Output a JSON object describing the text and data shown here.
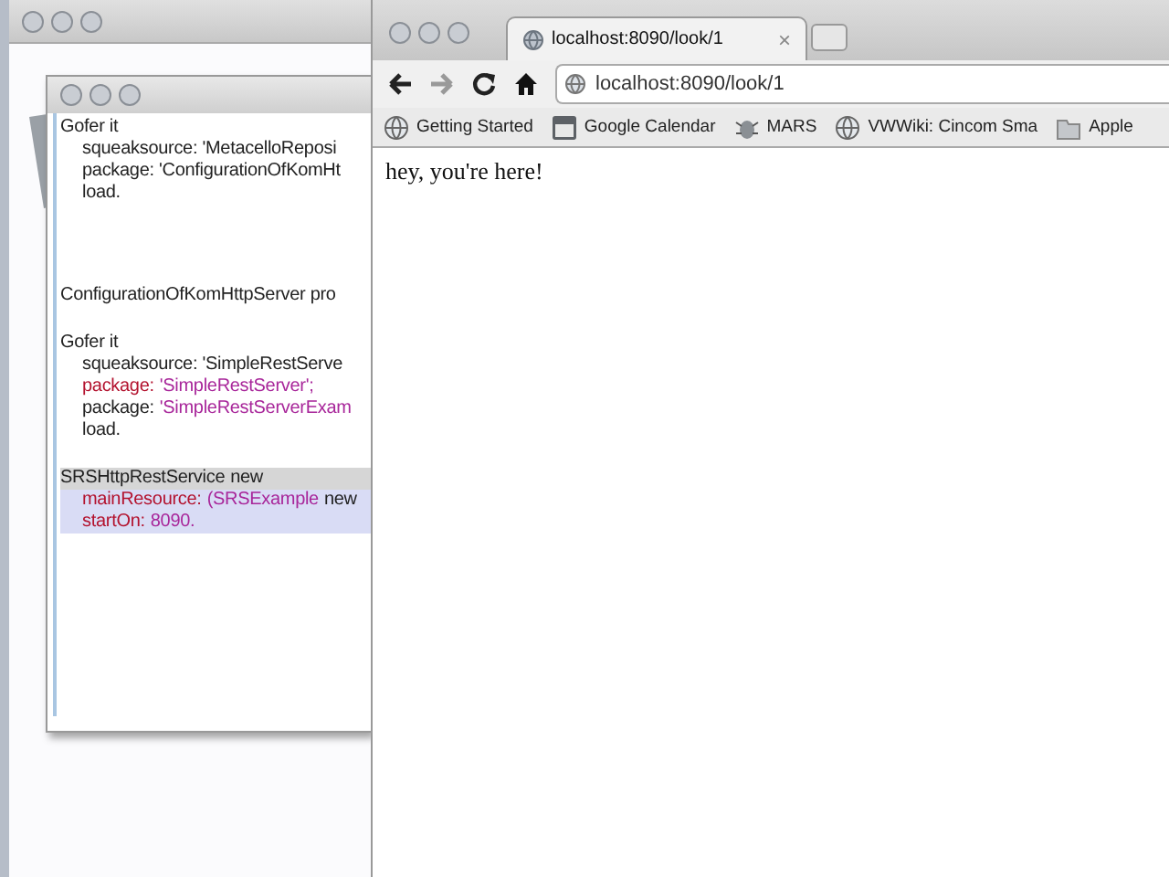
{
  "workspace": {
    "blocks": [
      {
        "lines": [
          {
            "segments": [
              {
                "text": "Gofer it",
                "kind": "plain"
              }
            ],
            "children": [
              {
                "segments": [
                  {
                    "text": "squeaksource: 'MetacelloReposi",
                    "kind": "plain"
                  }
                ]
              },
              {
                "segments": [
                  {
                    "text": "package: 'ConfigurationOfKomHt",
                    "kind": "plain"
                  }
                ]
              },
              {
                "segments": [
                  {
                    "text": "load.",
                    "kind": "plain"
                  }
                ]
              }
            ]
          }
        ]
      },
      {
        "lines": [
          {
            "segments": [
              {
                "text": "ConfigurationOfKomHttpServer pro",
                "kind": "plain"
              }
            ]
          }
        ]
      },
      {
        "lines": [
          {
            "segments": [
              {
                "text": "Gofer it",
                "kind": "plain"
              }
            ],
            "children": [
              {
                "segments": [
                  {
                    "text": "squeaksource: 'SimpleRestServe",
                    "kind": "plain"
                  }
                ]
              },
              {
                "segments": [
                  {
                    "text": "package:",
                    "kind": "keyword"
                  },
                  {
                    "text": "'SimpleRestServer';",
                    "kind": "string"
                  }
                ]
              },
              {
                "segments": [
                  {
                    "text": "package:",
                    "kind": "plain"
                  },
                  {
                    "text": "'SimpleRestServerExam",
                    "kind": "string"
                  }
                ]
              },
              {
                "segments": [
                  {
                    "text": "load.",
                    "kind": "plain"
                  }
                ]
              }
            ]
          }
        ]
      },
      {
        "lines": [
          {
            "color": "#d6d6d6",
            "segments": [
              {
                "text": "SRSHttpRestService",
                "kind": "plain"
              },
              {
                "text": "new",
                "kind": "plain"
              }
            ],
            "children": [
              {
                "color": "#d9dcf5",
                "segments": [
                  {
                    "text": "mainResource:",
                    "kind": "keyword"
                  },
                  {
                    "text": "(SRSExample",
                    "kind": "string"
                  },
                  {
                    "text": "new",
                    "kind": "plain"
                  }
                ]
              },
              {
                "color": "#d9dcf5",
                "segments": [
                  {
                    "text": "startOn:",
                    "kind": "keyword"
                  },
                  {
                    "text": "8090.",
                    "kind": "string"
                  }
                ]
              }
            ]
          }
        ]
      }
    ]
  },
  "browser": {
    "tabs": [
      {
        "label": "localhost:8090/look/1",
        "selected": true,
        "close": "×"
      }
    ],
    "address": "localhost:8090/look/1",
    "bookmarks": [
      {
        "label": "Getting Started",
        "kind": "globe"
      },
      {
        "label": "Google Calendar",
        "kind": "calendar"
      },
      {
        "label": "MARS",
        "kind": "bug"
      },
      {
        "label": "VWWiki: Cincom Sma",
        "kind": "globe"
      },
      {
        "label": "Apple",
        "kind": "folder"
      }
    ],
    "content": "hey, you're here!"
  }
}
